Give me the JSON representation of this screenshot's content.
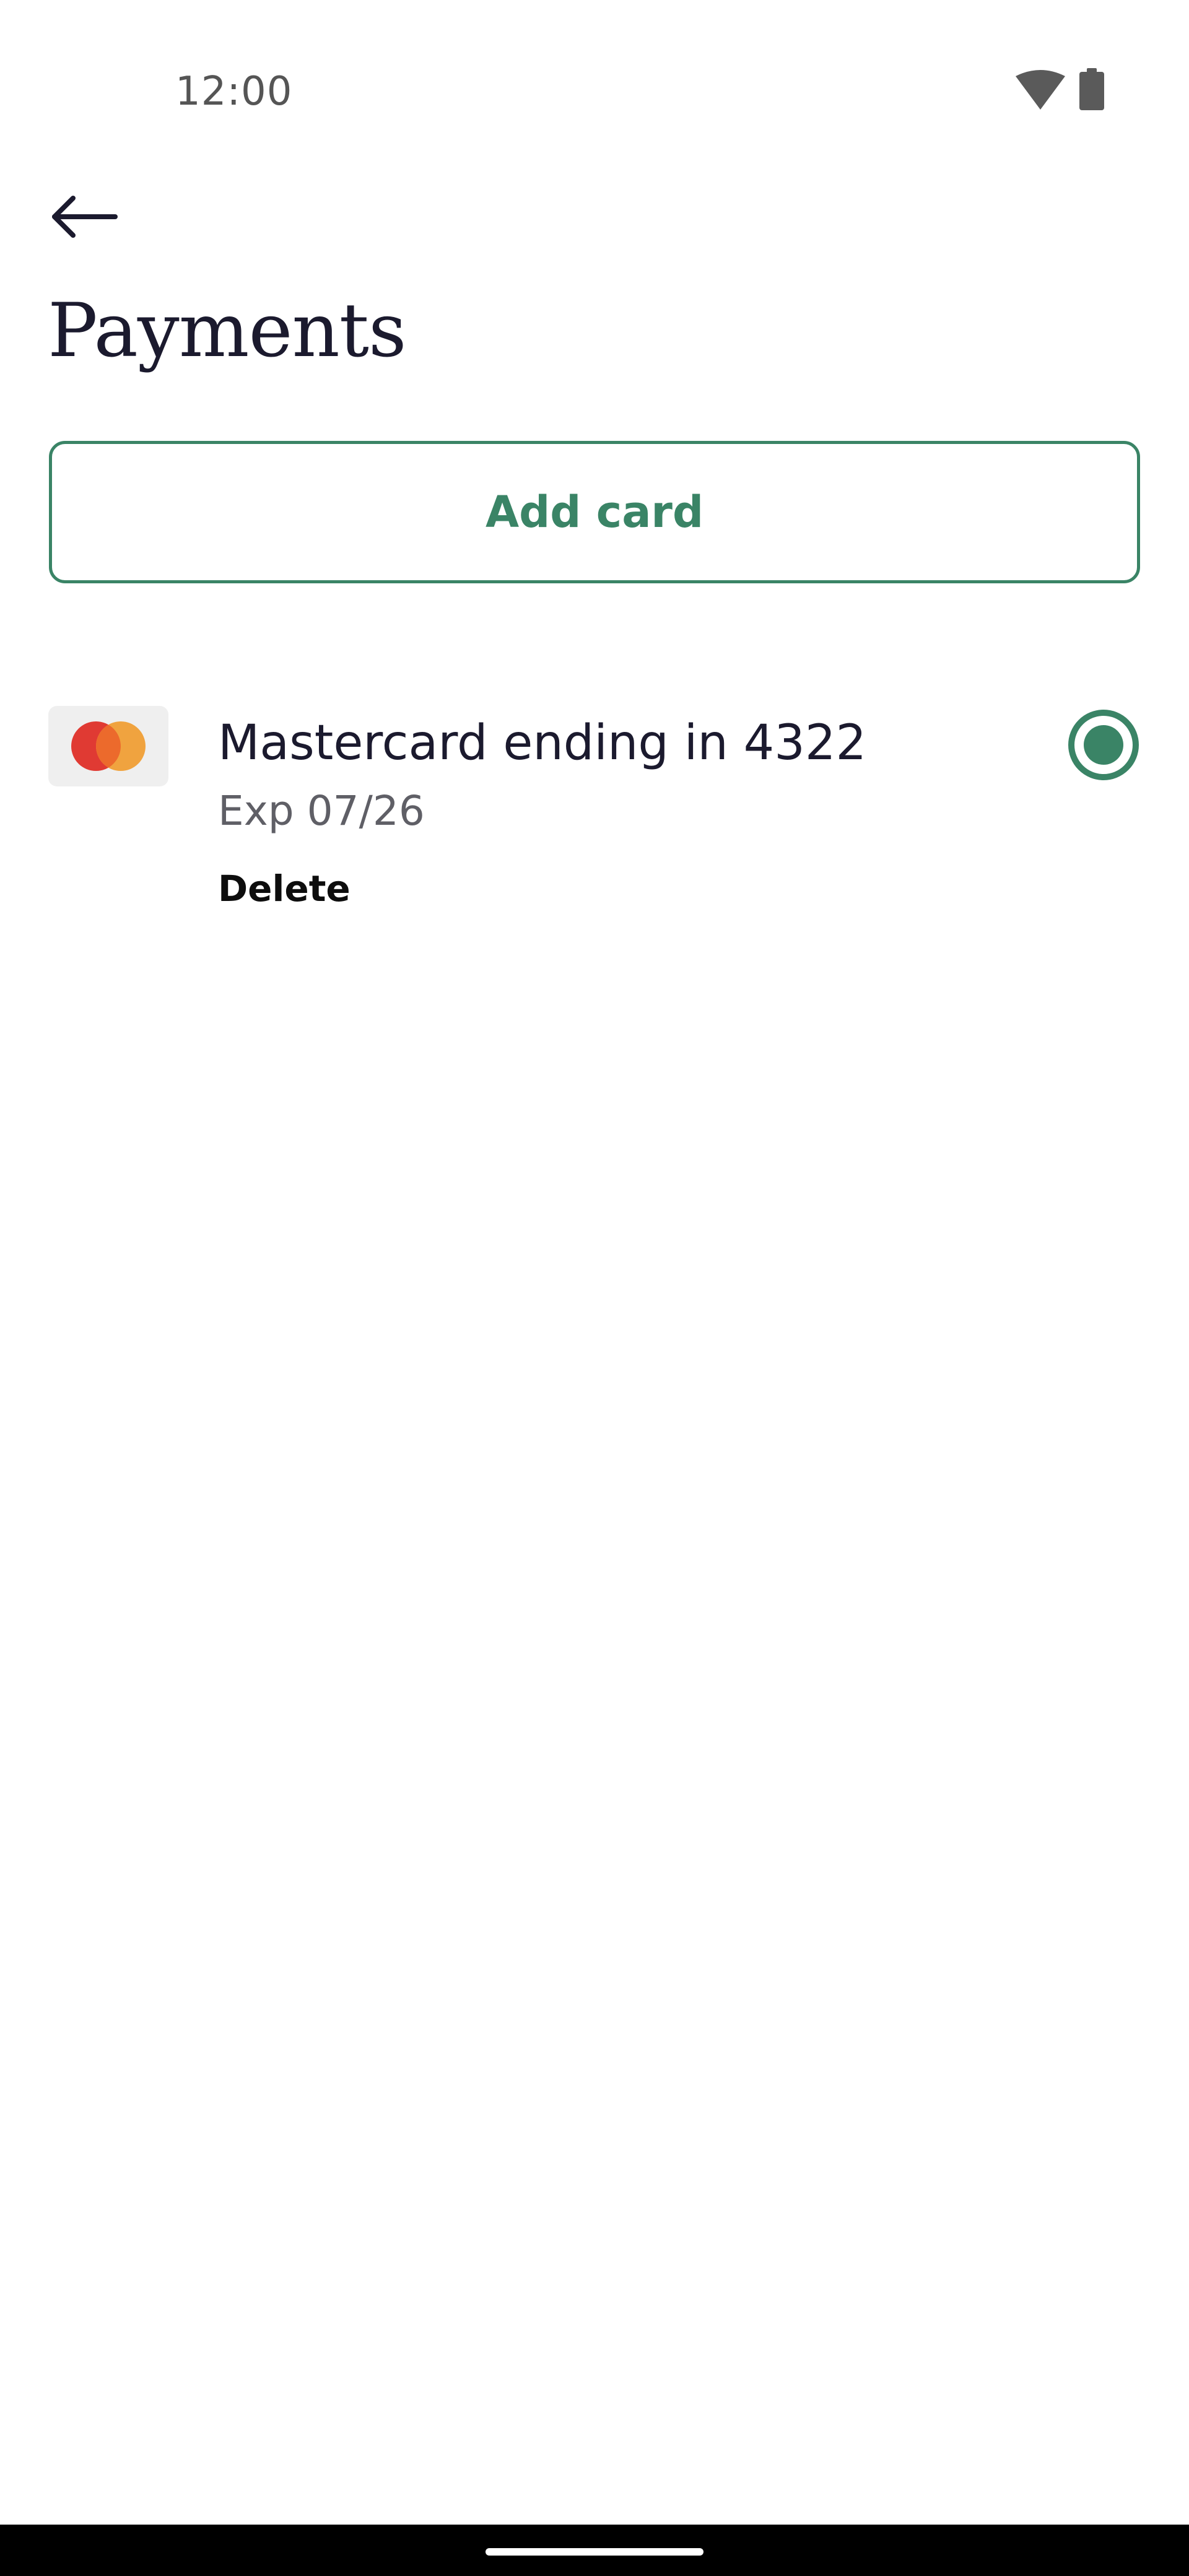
{
  "status_bar": {
    "time": "12:00",
    "icons": [
      "wifi-icon",
      "battery-icon"
    ]
  },
  "header": {
    "back_icon": "back-arrow-icon",
    "title": "Payments"
  },
  "actions": {
    "add_card_label": "Add card"
  },
  "cards": [
    {
      "brand_icon": "mastercard-icon",
      "name": "Mastercard ending in 4322",
      "expiry": "Exp 07/26",
      "delete_label": "Delete",
      "selected": true
    }
  ],
  "colors": {
    "accent": "#3a8466",
    "text_primary": "#1b1a2e",
    "text_secondary": "#5f5f66",
    "mastercard_red": "#e03a33",
    "mastercard_orange": "#f0a33f"
  }
}
